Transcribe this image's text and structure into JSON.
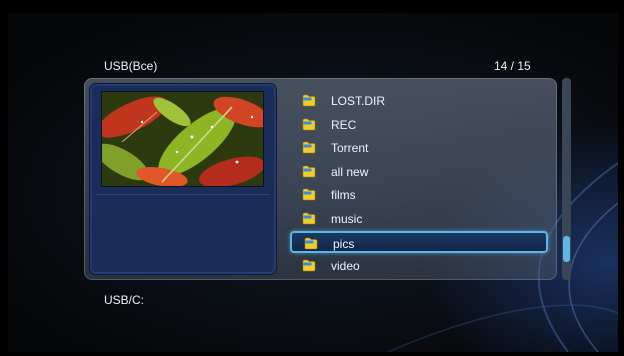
{
  "header": {
    "source_label": "USB(Bce)",
    "page_counter": "14 / 15"
  },
  "files": [
    {
      "label": "LOST.DIR",
      "icon": "folder-icon"
    },
    {
      "label": "REC",
      "icon": "folder-icon"
    },
    {
      "label": "Torrent",
      "icon": "folder-icon"
    },
    {
      "label": "all new",
      "icon": "folder-icon"
    },
    {
      "label": "films",
      "icon": "folder-icon"
    },
    {
      "label": "music",
      "icon": "folder-icon"
    },
    {
      "label": "pics",
      "icon": "folder-icon",
      "selected": true
    },
    {
      "label": "video",
      "icon": "folder-icon"
    }
  ],
  "scrollbar": {
    "position_fraction": 0.9
  },
  "footer": {
    "path": "USB/C:"
  },
  "colors": {
    "accent": "#59b8e8",
    "folder": "#f2cc2a",
    "preview_bg": "#1a2d58"
  }
}
